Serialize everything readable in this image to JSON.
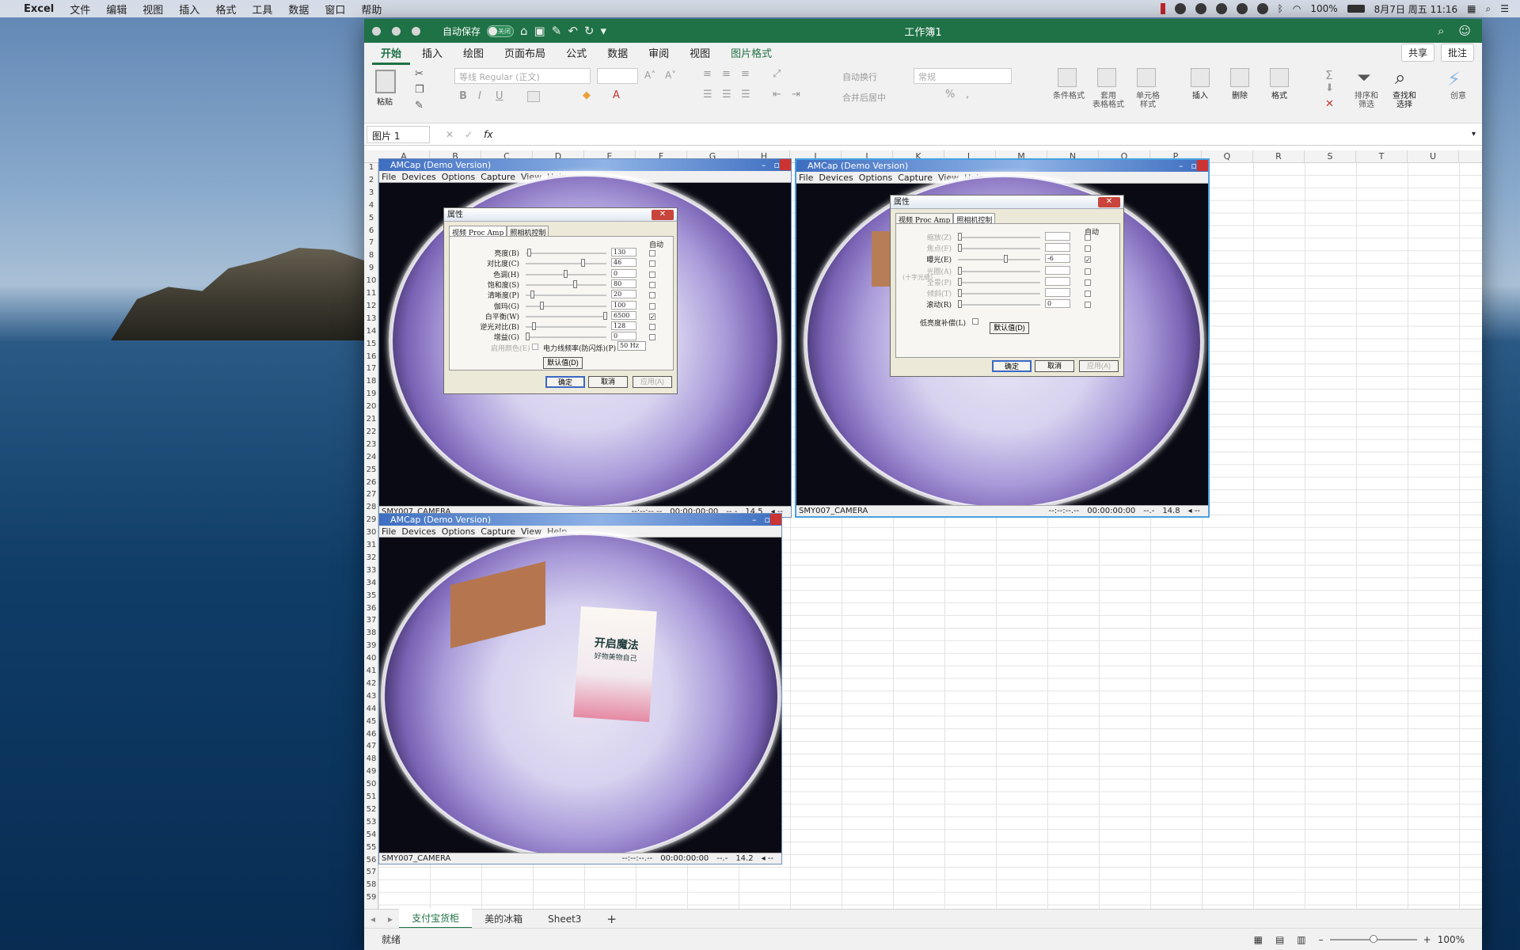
{
  "mac_menu": {
    "apple": "",
    "app": "Excel",
    "items": [
      "文件",
      "编辑",
      "视图",
      "插入",
      "格式",
      "工具",
      "数据",
      "窗口",
      "帮助"
    ],
    "status": {
      "battery": "100%",
      "datetime": "8月7日 周五 11:16"
    }
  },
  "excel": {
    "autosave_label": "自动保存",
    "autosave_state": "关闭",
    "title": "工作簿1",
    "tabs": [
      "开始",
      "插入",
      "绘图",
      "页面布局",
      "公式",
      "数据",
      "审阅",
      "视图",
      "图片格式"
    ],
    "share": "共享",
    "comments": "批注",
    "ribbon": {
      "paste": "粘贴",
      "font": "等线 Regular (正文)",
      "wrap": "自动换行",
      "merge": "合并后居中",
      "number_format": "常规",
      "cond_format": "条件格式",
      "table_format": "套用\n表格格式",
      "cell_style": "单元格\n样式",
      "insert": "插入",
      "delete": "删除",
      "format": "格式",
      "sort": "排序和\n筛选",
      "find": "查找和\n选择",
      "create": "创意"
    },
    "namebox": "图片 1",
    "fx": "fx",
    "columns": [
      "A",
      "B",
      "C",
      "D",
      "E",
      "F",
      "G",
      "H",
      "I",
      "J",
      "K",
      "L",
      "M",
      "N",
      "O",
      "P",
      "Q",
      "R",
      "S",
      "T",
      "U"
    ],
    "sheets": [
      "支付宝货柜",
      "美的冰箱",
      "Sheet3"
    ],
    "add_sheet": "+",
    "status_ready": "就绪",
    "zoom": "100%"
  },
  "amcap_windows": [
    {
      "title": "AMCap (Demo Version)",
      "menu": [
        "File",
        "Devices",
        "Options",
        "Capture",
        "View",
        "Help"
      ],
      "camera": "SMY007_CAMERA",
      "time1": "--:--:--.--",
      "time2": "00:00:00:00",
      "fps_prefix": "--.-",
      "fps": "14.5",
      "fps_suffix": "◂ --"
    },
    {
      "title": "AMCap (Demo Version)",
      "menu": [
        "File",
        "Devices",
        "Options",
        "Capture",
        "View",
        "Help"
      ],
      "camera": "SMY007_CAMERA",
      "time1": "--:--:--.--",
      "time2": "00:00:00:00",
      "fps_prefix": "--.-",
      "fps": "14.8",
      "fps_suffix": "◂ --"
    },
    {
      "title": "AMCap (Demo Version)",
      "menu": [
        "File",
        "Devices",
        "Options",
        "Capture",
        "View",
        "Help"
      ],
      "camera": "SMY007_CAMERA",
      "time1": "--:--:--.--",
      "time2": "00:00:00:00",
      "fps_prefix": "--.-",
      "fps": "14.2",
      "fps_suffix": "◂ --"
    }
  ],
  "dialog_proc": {
    "title": "属性",
    "close": "✕",
    "tabs": [
      "视频 Proc Amp",
      "照相机控制"
    ],
    "auto": "自动",
    "rows": [
      {
        "label": "亮度(B)",
        "value": "130",
        "checked": false
      },
      {
        "label": "对比度(C)",
        "value": "46",
        "checked": false
      },
      {
        "label": "色调(H)",
        "value": "0",
        "checked": false
      },
      {
        "label": "饱和度(S)",
        "value": "80",
        "checked": false
      },
      {
        "label": "清晰度(P)",
        "value": "20",
        "checked": false
      },
      {
        "label": "伽玛(G)",
        "value": "100",
        "checked": false
      },
      {
        "label": "白平衡(W)",
        "value": "6500",
        "checked": true
      },
      {
        "label": "逆光对比(B)",
        "value": "128",
        "checked": false
      },
      {
        "label": "增益(G)",
        "value": "0",
        "checked": false
      }
    ],
    "color_enable": "启用颜色(E)",
    "powerline": "电力线频率(防闪烁)(P)",
    "powerline_value": "50 Hz",
    "default": "默认值(D)",
    "ok": "确定",
    "cancel": "取消",
    "apply": "应用(A)"
  },
  "dialog_cam": {
    "title": "属性",
    "close": "✕",
    "tabs": [
      "视频 Proc Amp",
      "照相机控制"
    ],
    "auto": "自动",
    "rows": [
      {
        "label": "缩放(Z)",
        "value": "",
        "checked": false,
        "disabled": true
      },
      {
        "label": "焦点(F)",
        "value": "",
        "checked": false,
        "disabled": true
      },
      {
        "label": "曝光(E)",
        "value": "-6",
        "checked": true,
        "disabled": false
      },
      {
        "label": "光圈(A)",
        "value": "",
        "checked": false,
        "disabled": true
      },
      {
        "label": "全景(P)",
        "value": "",
        "checked": false,
        "disabled": true
      },
      {
        "label": "倾斜(T)",
        "value": "",
        "checked": false,
        "disabled": true
      },
      {
        "label": "滚动(R)",
        "value": "0",
        "checked": false,
        "disabled": false
      }
    ],
    "iris_sub": "(十字光缝)",
    "lowlight": "低亮度补偿(L)",
    "default": "默认值(D)",
    "ok": "确定",
    "cancel": "取消",
    "apply": "应用(A)"
  },
  "product_card": {
    "line1": "开启魔法",
    "line2": "好物美物自己"
  }
}
